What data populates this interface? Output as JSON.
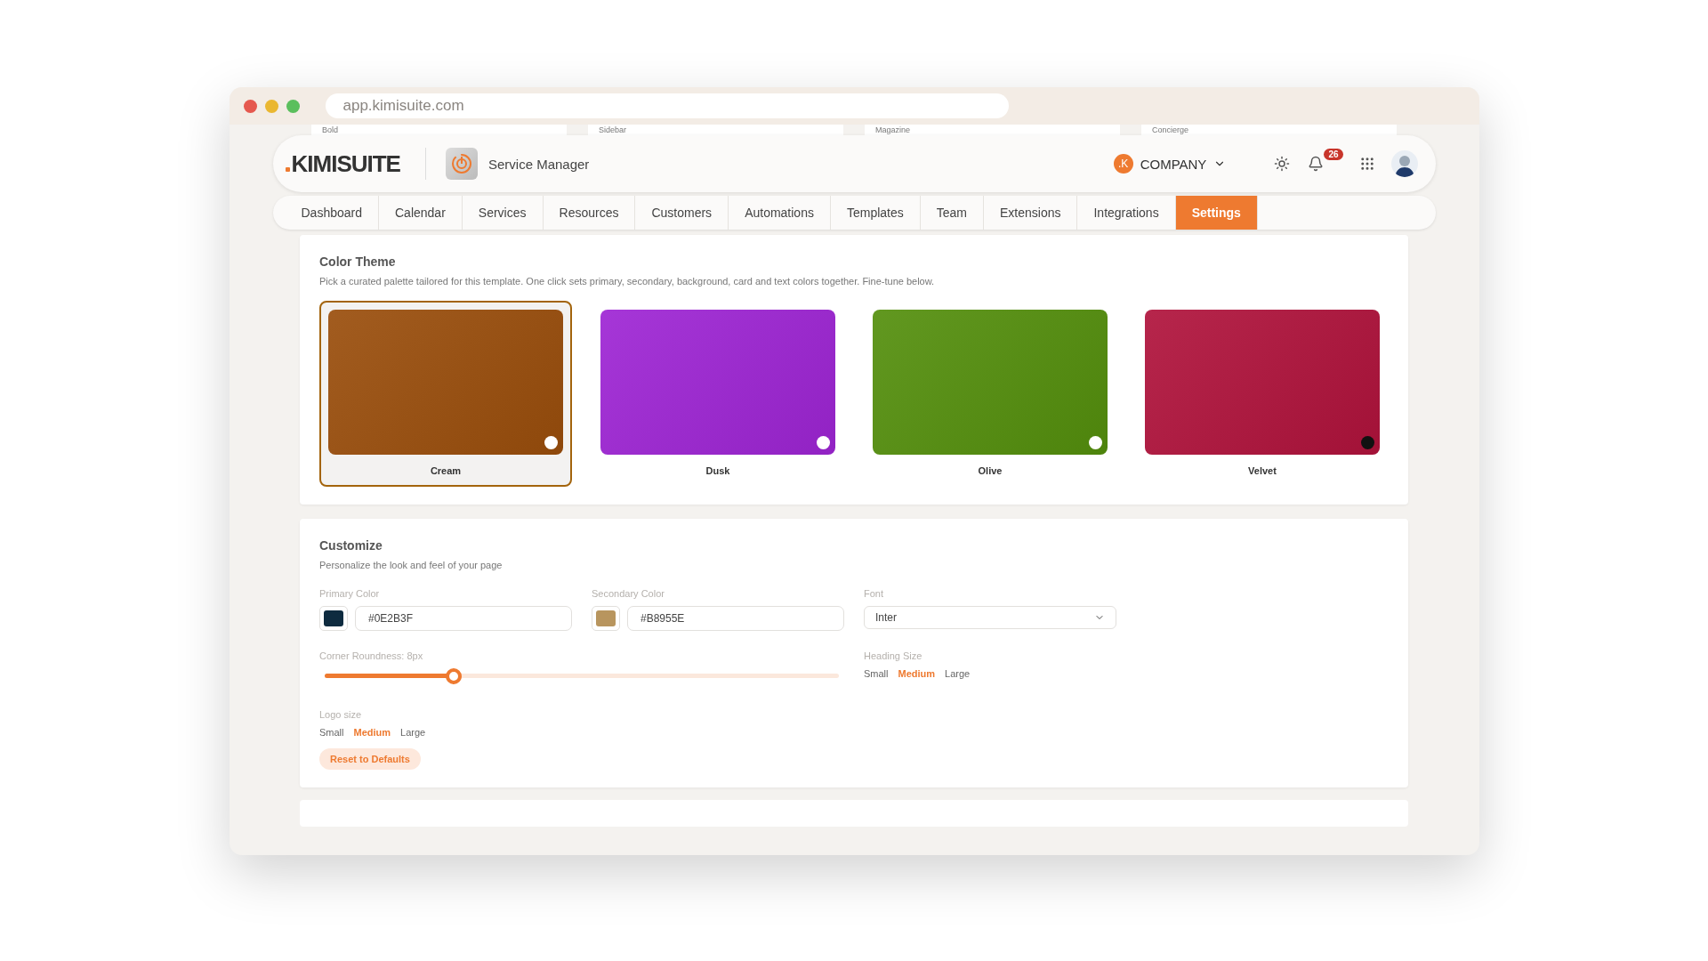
{
  "browser": {
    "url": "app.kimisuite.com"
  },
  "template_strip": [
    "Bold",
    "Sidebar",
    "Magazine",
    "Concierge"
  ],
  "header": {
    "logo": "KIMISUITE",
    "app_name": "Service Manager",
    "company_badge": ".K",
    "company": "COMPANY",
    "notification_count": "26"
  },
  "tabs": [
    {
      "label": "Dashboard",
      "selected": false
    },
    {
      "label": "Calendar",
      "selected": false
    },
    {
      "label": "Services",
      "selected": false
    },
    {
      "label": "Resources",
      "selected": false
    },
    {
      "label": "Customers",
      "selected": false
    },
    {
      "label": "Automations",
      "selected": false
    },
    {
      "label": "Templates",
      "selected": false
    },
    {
      "label": "Team",
      "selected": false
    },
    {
      "label": "Extensions",
      "selected": false
    },
    {
      "label": "Integrations",
      "selected": false
    },
    {
      "label": "Settings",
      "selected": true
    }
  ],
  "color_theme": {
    "title": "Color Theme",
    "description": "Pick a curated palette tailored for this template. One click sets primary, secondary, background, card and text colors together. Fine-tune below.",
    "palettes": [
      {
        "name": "Cream",
        "selected": true,
        "color": "#9a4e0c",
        "dot": {
          "color": "#ffffff"
        }
      },
      {
        "name": "Dusk",
        "selected": false,
        "color": "#9e25d4",
        "dot": {
          "color": "#ffffff"
        }
      },
      {
        "name": "Olive",
        "selected": false,
        "color": "#548f0d",
        "dot": {
          "color": "#ffffff"
        }
      },
      {
        "name": "Velvet",
        "selected": false,
        "color": "#b0133c",
        "dot": {
          "color": "#111111"
        }
      }
    ]
  },
  "customize": {
    "title": "Customize",
    "description": "Personalize the look and feel of your page",
    "primary_color": {
      "label": "Primary Color",
      "value": "#0E2B3F",
      "color": "#0e2b3f"
    },
    "secondary_color": {
      "label": "Secondary Color",
      "value": "#B8955E",
      "color": "#b8955e"
    },
    "font": {
      "label": "Font",
      "value": "Inter"
    },
    "corner_roundness": {
      "label": "Corner Roundness: 8px",
      "level": 0.25
    },
    "heading_size": {
      "label": "Heading Size",
      "options": [
        {
          "label": "Small",
          "selected": false
        },
        {
          "label": "Medium",
          "selected": true
        },
        {
          "label": "Large",
          "selected": false
        }
      ]
    },
    "logo_size": {
      "label": "Logo size",
      "options": [
        {
          "label": "Small",
          "selected": false
        },
        {
          "label": "Medium",
          "selected": true
        },
        {
          "label": "Large",
          "selected": false
        }
      ]
    },
    "reset_button": "Reset to Defaults"
  }
}
